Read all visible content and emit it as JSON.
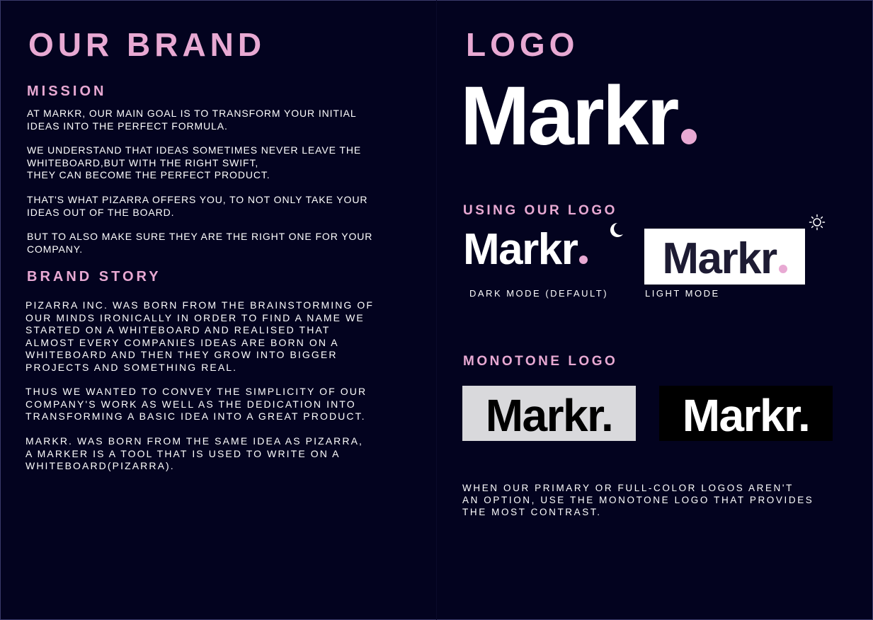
{
  "left": {
    "title": "OUR BRAND",
    "mission_heading": "MISSION",
    "mission_paragraphs": [
      "AT MARKR, OUR MAIN GOAL IS TO TRANSFORM YOUR INITIAL\nIDEAS INTO THE PERFECT FORMULA.",
      "WE UNDERSTAND THAT IDEAS SOMETIMES NEVER LEAVE THE\nWHITEBOARD,BUT WITH THE RIGHT SWIFT,\nTHEY CAN BECOME THE PERFECT PRODUCT.",
      "THAT'S WHAT PIZARRA OFFERS YOU, TO NOT ONLY TAKE YOUR\nIDEAS OUT OF THE BOARD.",
      "BUT TO ALSO MAKE SURE THEY ARE THE RIGHT ONE FOR YOUR\nCOMPANY."
    ],
    "story_heading": "BRAND STORY",
    "story_paragraphs": [
      "PIZARRA INC. WAS BORN FROM THE BRAINSTORMING OF\nOUR MINDS IRONICALLY IN ORDER TO FIND A NAME WE\nSTARTED ON A WHITEBOARD AND REALISED THAT\nALMOST EVERY COMPANIES IDEAS ARE BORN ON A\nWHITEBOARD AND THEN THEY GROW INTO BIGGER\nPROJECTS AND SOMETHING REAL.",
      "THUS WE WANTED TO CONVEY THE SIMPLICITY OF OUR\nCOMPANY'S WORK AS WELL AS THE DEDICATION INTO\nTRANSFORMING A BASIC IDEA INTO A GREAT PRODUCT.",
      "MARKR. WAS BORN FROM THE SAME IDEA AS PIZARRA,\nA MARKER IS A TOOL THAT IS USED TO WRITE ON A\nWHITEBOARD(PIZARRA)."
    ]
  },
  "right": {
    "title": "LOGO",
    "logo_text": "Markr",
    "using_heading": "USING OUR LOGO",
    "dark_caption": "DARK MODE (DEFAULT)",
    "light_caption": "LIGHT MODE",
    "moon_icon": "moon-icon",
    "sun_icon": "sun-icon",
    "monotone_heading": "MONOTONE LOGO",
    "monotone_logo_text": "Markr.",
    "footnote": "WHEN  OUR  PRIMARY  OR  FULL-COLOR  LOGOS  AREN'T\nAN OPTION, USE THE MONOTONE LOGO THAT PROVIDES\nTHE MOST CONTRAST."
  },
  "colors": {
    "background": "#03031f",
    "accent_pink": "#e8a9d3",
    "light_box": "#ffffff",
    "dark_ink": "#1d1b33",
    "grey_box": "#d9d9dc",
    "black_box": "#000000"
  }
}
